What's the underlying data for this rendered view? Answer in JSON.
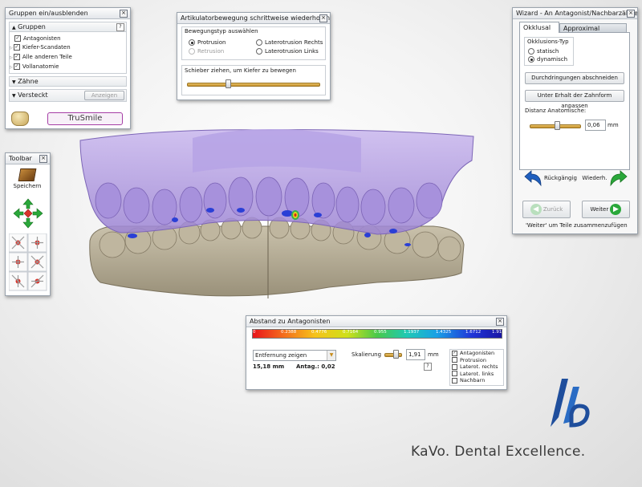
{
  "groups_panel": {
    "title": "Gruppen ein/ausblenden",
    "groups_header": "Gruppen",
    "help": "?",
    "items": [
      {
        "label": "Antagonisten",
        "checked": true
      },
      {
        "label": "Kiefer-Scandaten",
        "checked": true
      },
      {
        "label": "Alle anderen Teile",
        "checked": true
      },
      {
        "label": "Vollanatomie",
        "checked": true
      }
    ],
    "teeth_header": "Zähne",
    "hidden_header": "Versteckt",
    "show_button": "Anzeigen",
    "trusmile_button": "TruSmile"
  },
  "articulator_panel": {
    "title": "Artikulatorbewegung schrittweise wiederholen",
    "movement_label": "Bewegungstyp auswählen",
    "options": [
      {
        "label": "Protrusion",
        "selected": true,
        "disabled": false
      },
      {
        "label": "Laterotrusion Rechts",
        "selected": false,
        "disabled": false
      },
      {
        "label": "Retrusion",
        "selected": false,
        "disabled": true
      },
      {
        "label": "Laterotrusion Links",
        "selected": false,
        "disabled": false
      }
    ],
    "slider_label": "Schieber ziehen, um Kiefer zu bewegen",
    "slider_position": 0.28
  },
  "wizard_panel": {
    "title": "Wizard - An Antagonist/Nachbarzähne...",
    "tabs": [
      "Okklusal",
      "Approximal"
    ],
    "active_tab": "Okklusal",
    "occlusion_type_label": "Okklusions-Typ",
    "types": [
      {
        "label": "statisch",
        "selected": false
      },
      {
        "label": "dynamisch",
        "selected": true
      }
    ],
    "penetration_button": "Durchdringungen abschneiden",
    "adapt_button": "Unter Erhalt der Zahnform anpassen",
    "distance_label": "Distanz Anatomische:",
    "distance_value": "0,06",
    "distance_unit": "mm",
    "distance_slider_position": 0.55,
    "undo_button": "Rückgängig",
    "redo_button": "Wiederh.",
    "back_button": "Zurück",
    "next_button": "Weiter",
    "hint": "'Weiter' um Teile zusammenzufügen"
  },
  "toolbar_panel": {
    "title": "Toolbar",
    "save_label": "Speichern"
  },
  "distance_panel": {
    "title": "Abstand zu Antagonisten",
    "scale_ticks": [
      "0",
      "0.2388",
      "0.4776",
      "0.7164",
      "0.955",
      "1.1937",
      "1.4325",
      "1.6712",
      "1.91"
    ],
    "dropdown_value": "Entfernung zeigen",
    "scaling_label": "Skalierung",
    "scaling_value": "1,91",
    "scaling_unit": "mm",
    "help": "?",
    "distance_value": "15,18 mm",
    "antag_label": "Antag.: 0,02",
    "checkboxes": [
      {
        "label": "Antagonisten",
        "checked": true
      },
      {
        "label": "Protrusion",
        "checked": false
      },
      {
        "label": "Laterot. rechts",
        "checked": false
      },
      {
        "label": "Laterot. links",
        "checked": false
      },
      {
        "label": "Nachbarn",
        "checked": false
      }
    ]
  },
  "branding": {
    "tagline": "KaVo. Dental Excellence.",
    "logo_text": "KaVo"
  },
  "colors": {
    "upper_jaw": "#a88fd8",
    "lower_jaw": "#b6ad96",
    "brand_blue": "#1f4e9c",
    "accent_green": "#2aa83a",
    "undo_blue": "#1f5fbf"
  }
}
